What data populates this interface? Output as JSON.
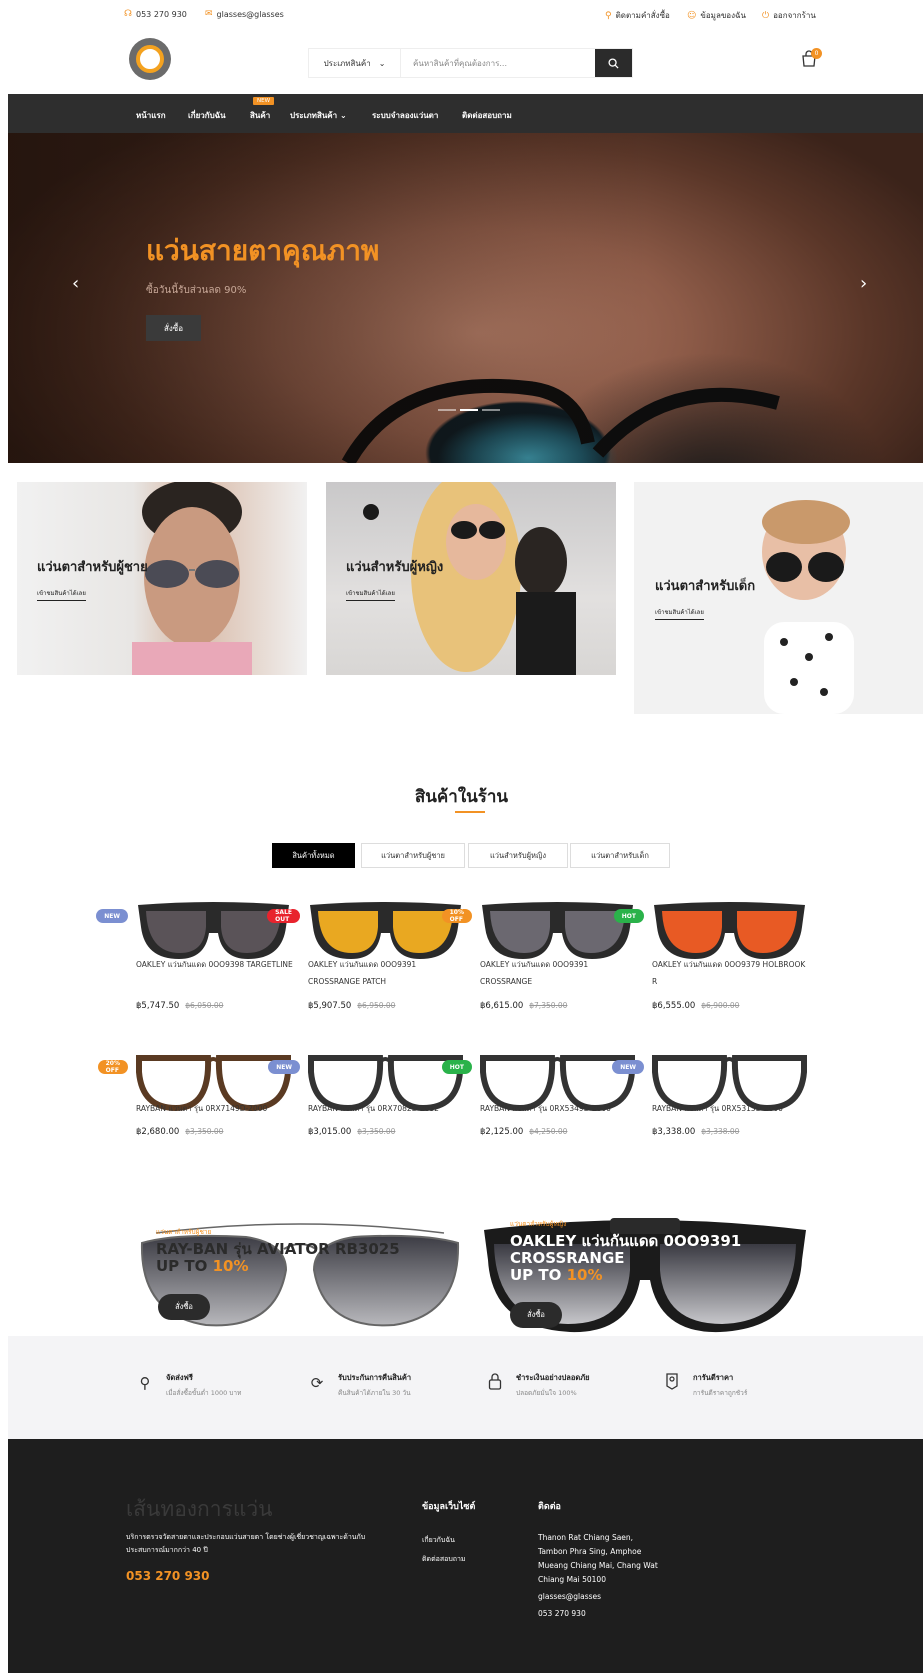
{
  "topbar": {
    "phone": "053 270 930",
    "email": "glasses@glasses",
    "track": "ติดตามคำสั่งซื้อ",
    "account": "ข้อมูลของฉัน",
    "logout": "ออกจากร้าน"
  },
  "header": {
    "category_select": "ประเภทสินค้า",
    "search_placeholder": "ค้นหาสินค้าที่คุณต้องการ...",
    "cart_count": "0"
  },
  "nav": {
    "items": [
      "หน้าแรก",
      "เกี่ยวกับฉัน",
      "สินค้า",
      "ประเภทสินค้า",
      "ระบบจำลองแว่นตา",
      "ติดต่อสอบถาม"
    ],
    "new_badge": "NEW"
  },
  "hero": {
    "title": "แว่นสายตาคุณภาพ",
    "subtitle": "ซื้อวันนี้รับส่วนลด 90%",
    "button": "สั่งซื้อ"
  },
  "categories": [
    {
      "title": "แว่นตาสำหรับผู้ชาย",
      "link": "เข้าชมสินค้าได้เลย"
    },
    {
      "title": "แว่นสำหรับผู้หญิง",
      "link": "เข้าชมสินค้าได้เลย"
    },
    {
      "title": "แว่นตาสำหรับเด็ก",
      "link": "เข้าชมสินค้าได้เลย"
    }
  ],
  "products_section": {
    "title": "สินค้าในร้าน",
    "tabs": [
      "สินค้าทั้งหมด",
      "แว่นตาสำหรับผู้ชาย",
      "แว่นสำหรับผู้หญิง",
      "แว่นตาสำหรับเด็ก"
    ]
  },
  "products": [
    {
      "name": "OAKLEY แว่นกันแดด 0OO9398 TARGETLINE",
      "price": "฿5,747.50",
      "old": "฿6,050.00",
      "badge": "NEW"
    },
    {
      "name": "OAKLEY แว่นกันแดด 0OO9391 CROSSRANGE PATCH",
      "price": "฿5,907.50",
      "old": "฿6,950.00",
      "badge": "SALE OUT"
    },
    {
      "name": "OAKLEY แว่นกันแดด 0OO9391 CROSSRANGE",
      "price": "฿6,615.00",
      "old": "฿7,350.00",
      "badge": "10% OFF"
    },
    {
      "name": "OAKLEY แว่นกันแดด 0OO9379 HOLBROOK R",
      "price": "฿6,555.00",
      "old": "฿6,900.00",
      "badge": "HOT"
    },
    {
      "name": "RAYBAN แว่นตา รุ่น 0RX7149D-2000",
      "price": "฿2,680.00",
      "old": "฿3,350.00",
      "badge": "20% OFF"
    },
    {
      "name": "RAYBAN แว่นตา รุ่น 0RX7082D 2012",
      "price": "฿3,015.00",
      "old": "฿3,350.00",
      "badge": "NEW"
    },
    {
      "name": "RAYBAN แว่นตา รุ่น 0RX5349D 2000",
      "price": "฿2,125.00",
      "old": "฿4,250.00",
      "badge": "HOT"
    },
    {
      "name": "RAYBAN แว่นตา รุ่น 0RX5315D 2000",
      "price": "฿3,338.00",
      "old": "฿3,338.00",
      "badge": "NEW"
    }
  ],
  "promos": [
    {
      "sub": "แว่นตาสำหรับผู้ชาย",
      "line1": "RAY-BAN รุ่น AVIATOR RB3025",
      "line2": "UP TO ",
      "pct": "10%",
      "button": "สั่งซื้อ"
    },
    {
      "sub": "แว่นตาสำหรับผู้หญิง",
      "line1": "OAKLEY แว่นกันแดด 0OO9391",
      "line1b": "CROSSRANGE",
      "line2": "UP TO ",
      "pct": "10%",
      "button": "สั่งซื้อ"
    }
  ],
  "features": [
    {
      "title": "จัดส่งฟรี",
      "desc": "เมื่อสั่งซื้อขั้นต่ำ 1000 บาท"
    },
    {
      "title": "รับประกันการคืนสินค้า",
      "desc": "คืนสินค้าได้ภายใน 30 วัน"
    },
    {
      "title": "ชำระเงินอย่างปลอดภัย",
      "desc": "ปลอดภัยมั่นใจ 100%"
    },
    {
      "title": "การันตีราคา",
      "desc": "การันตีราคาถูกชัวร์"
    }
  ],
  "footer": {
    "brand": "เส้นทองการแว่น",
    "desc": "บริการตรวจวัดสายตาและประกอบแว่นสายตา โดยช่างผู้เชี่ยวชาญเฉพาะด้านกับประสบการณ์มากกว่า 40 ปี",
    "phone": "053 270 930",
    "col1_title": "ข้อมูลเว็บไซต์",
    "col1_links": [
      "เกี่ยวกับฉัน",
      "ติดต่อสอบถาม"
    ],
    "col2_title": "ติดต่อ",
    "address": [
      "Thanon Rat Chiang Saen,",
      "Tambon Phra Sing, Amphoe",
      "Mueang Chiang Mai, Chang Wat",
      "Chiang Mai 50100"
    ],
    "email": "glasses@glasses",
    "phone2": "053 270 930"
  },
  "colors": {
    "accent": "#f29224",
    "dark": "#2e2e2e",
    "badge_new": "#7b8fd1",
    "badge_sale": "#e8232d",
    "badge_hot": "#2ab24a"
  }
}
